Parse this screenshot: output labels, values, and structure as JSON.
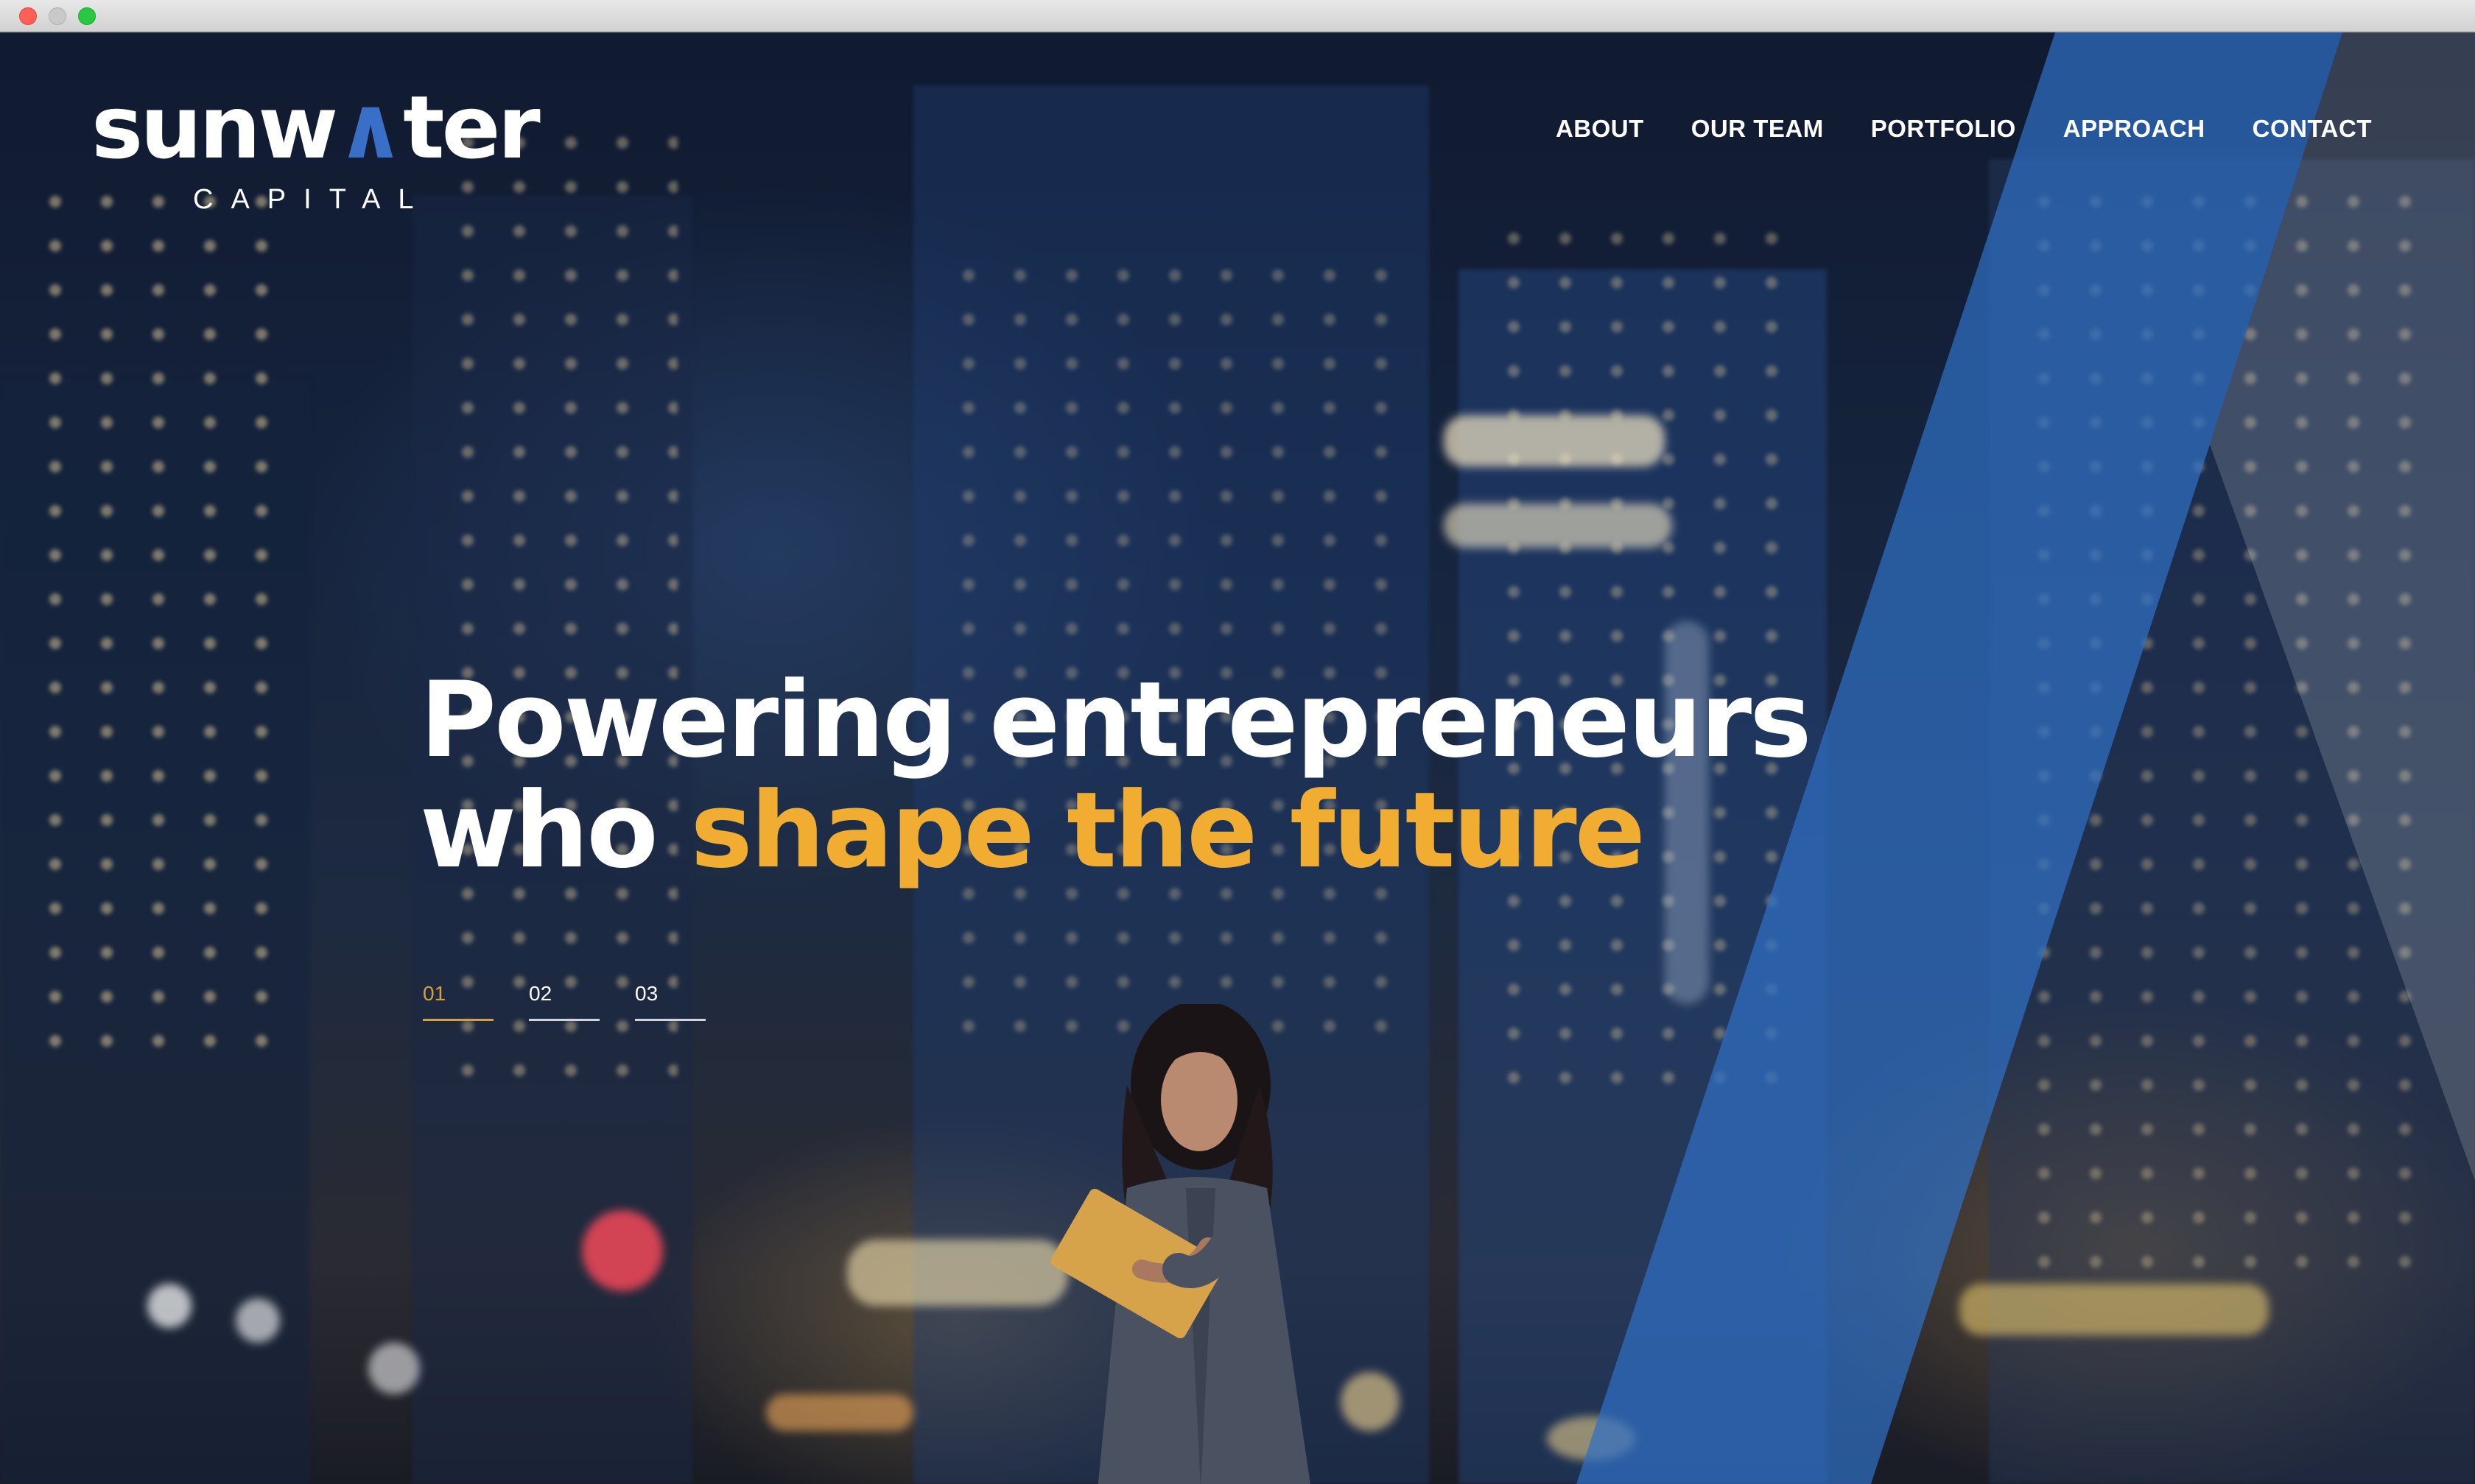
{
  "browser": {
    "controls": [
      "close-button",
      "minimize-button",
      "maximize-button"
    ]
  },
  "logo": {
    "word_pre": "sunw",
    "word_accent": "∧",
    "word_post": "ter",
    "sub": "CAPITAL"
  },
  "nav": {
    "items": [
      {
        "label": "ABOUT"
      },
      {
        "label": "OUR TEAM"
      },
      {
        "label": "PORTFOLIO"
      },
      {
        "label": "APPROACH"
      },
      {
        "label": "CONTACT"
      }
    ]
  },
  "hero": {
    "line1": "Powering entrepreneurs",
    "line2_pre": "who ",
    "line2_highlight": "shape the future",
    "slides": [
      {
        "label": "01",
        "active": true
      },
      {
        "label": "02",
        "active": false
      },
      {
        "label": "03",
        "active": false
      }
    ]
  },
  "colors": {
    "accent_gold": "#f0ad32",
    "brand_blue": "#2f6fc4",
    "text_white": "#ffffff"
  }
}
